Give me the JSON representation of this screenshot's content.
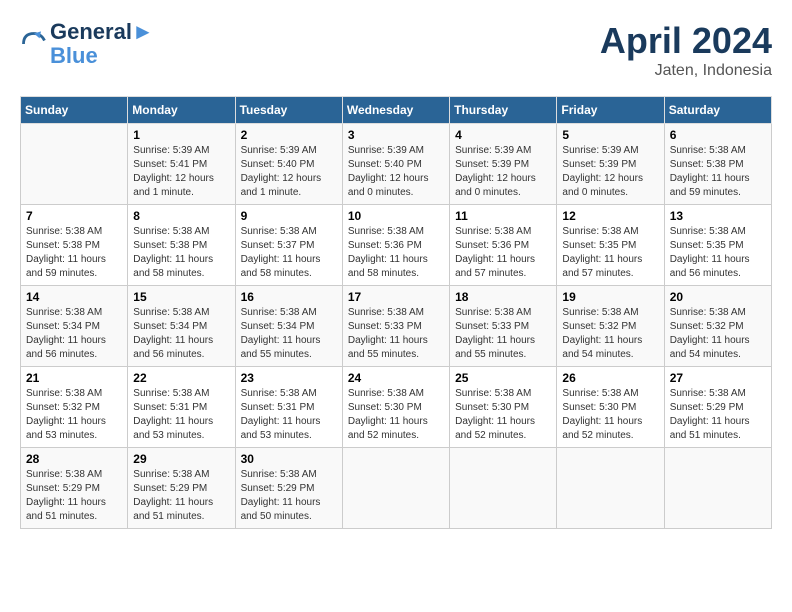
{
  "header": {
    "logo_line1": "General",
    "logo_line2": "Blue",
    "month_year": "April 2024",
    "location": "Jaten, Indonesia"
  },
  "days_of_week": [
    "Sunday",
    "Monday",
    "Tuesday",
    "Wednesday",
    "Thursday",
    "Friday",
    "Saturday"
  ],
  "weeks": [
    [
      {
        "day": "",
        "info": ""
      },
      {
        "day": "1",
        "info": "Sunrise: 5:39 AM\nSunset: 5:41 PM\nDaylight: 12 hours\nand 1 minute."
      },
      {
        "day": "2",
        "info": "Sunrise: 5:39 AM\nSunset: 5:40 PM\nDaylight: 12 hours\nand 1 minute."
      },
      {
        "day": "3",
        "info": "Sunrise: 5:39 AM\nSunset: 5:40 PM\nDaylight: 12 hours\nand 0 minutes."
      },
      {
        "day": "4",
        "info": "Sunrise: 5:39 AM\nSunset: 5:39 PM\nDaylight: 12 hours\nand 0 minutes."
      },
      {
        "day": "5",
        "info": "Sunrise: 5:39 AM\nSunset: 5:39 PM\nDaylight: 12 hours\nand 0 minutes."
      },
      {
        "day": "6",
        "info": "Sunrise: 5:38 AM\nSunset: 5:38 PM\nDaylight: 11 hours\nand 59 minutes."
      }
    ],
    [
      {
        "day": "7",
        "info": "Sunrise: 5:38 AM\nSunset: 5:38 PM\nDaylight: 11 hours\nand 59 minutes."
      },
      {
        "day": "8",
        "info": "Sunrise: 5:38 AM\nSunset: 5:38 PM\nDaylight: 11 hours\nand 58 minutes."
      },
      {
        "day": "9",
        "info": "Sunrise: 5:38 AM\nSunset: 5:37 PM\nDaylight: 11 hours\nand 58 minutes."
      },
      {
        "day": "10",
        "info": "Sunrise: 5:38 AM\nSunset: 5:36 PM\nDaylight: 11 hours\nand 58 minutes."
      },
      {
        "day": "11",
        "info": "Sunrise: 5:38 AM\nSunset: 5:36 PM\nDaylight: 11 hours\nand 57 minutes."
      },
      {
        "day": "12",
        "info": "Sunrise: 5:38 AM\nSunset: 5:35 PM\nDaylight: 11 hours\nand 57 minutes."
      },
      {
        "day": "13",
        "info": "Sunrise: 5:38 AM\nSunset: 5:35 PM\nDaylight: 11 hours\nand 56 minutes."
      }
    ],
    [
      {
        "day": "14",
        "info": "Sunrise: 5:38 AM\nSunset: 5:34 PM\nDaylight: 11 hours\nand 56 minutes."
      },
      {
        "day": "15",
        "info": "Sunrise: 5:38 AM\nSunset: 5:34 PM\nDaylight: 11 hours\nand 56 minutes."
      },
      {
        "day": "16",
        "info": "Sunrise: 5:38 AM\nSunset: 5:34 PM\nDaylight: 11 hours\nand 55 minutes."
      },
      {
        "day": "17",
        "info": "Sunrise: 5:38 AM\nSunset: 5:33 PM\nDaylight: 11 hours\nand 55 minutes."
      },
      {
        "day": "18",
        "info": "Sunrise: 5:38 AM\nSunset: 5:33 PM\nDaylight: 11 hours\nand 55 minutes."
      },
      {
        "day": "19",
        "info": "Sunrise: 5:38 AM\nSunset: 5:32 PM\nDaylight: 11 hours\nand 54 minutes."
      },
      {
        "day": "20",
        "info": "Sunrise: 5:38 AM\nSunset: 5:32 PM\nDaylight: 11 hours\nand 54 minutes."
      }
    ],
    [
      {
        "day": "21",
        "info": "Sunrise: 5:38 AM\nSunset: 5:32 PM\nDaylight: 11 hours\nand 53 minutes."
      },
      {
        "day": "22",
        "info": "Sunrise: 5:38 AM\nSunset: 5:31 PM\nDaylight: 11 hours\nand 53 minutes."
      },
      {
        "day": "23",
        "info": "Sunrise: 5:38 AM\nSunset: 5:31 PM\nDaylight: 11 hours\nand 53 minutes."
      },
      {
        "day": "24",
        "info": "Sunrise: 5:38 AM\nSunset: 5:30 PM\nDaylight: 11 hours\nand 52 minutes."
      },
      {
        "day": "25",
        "info": "Sunrise: 5:38 AM\nSunset: 5:30 PM\nDaylight: 11 hours\nand 52 minutes."
      },
      {
        "day": "26",
        "info": "Sunrise: 5:38 AM\nSunset: 5:30 PM\nDaylight: 11 hours\nand 52 minutes."
      },
      {
        "day": "27",
        "info": "Sunrise: 5:38 AM\nSunset: 5:29 PM\nDaylight: 11 hours\nand 51 minutes."
      }
    ],
    [
      {
        "day": "28",
        "info": "Sunrise: 5:38 AM\nSunset: 5:29 PM\nDaylight: 11 hours\nand 51 minutes."
      },
      {
        "day": "29",
        "info": "Sunrise: 5:38 AM\nSunset: 5:29 PM\nDaylight: 11 hours\nand 51 minutes."
      },
      {
        "day": "30",
        "info": "Sunrise: 5:38 AM\nSunset: 5:29 PM\nDaylight: 11 hours\nand 50 minutes."
      },
      {
        "day": "",
        "info": ""
      },
      {
        "day": "",
        "info": ""
      },
      {
        "day": "",
        "info": ""
      },
      {
        "day": "",
        "info": ""
      }
    ]
  ]
}
